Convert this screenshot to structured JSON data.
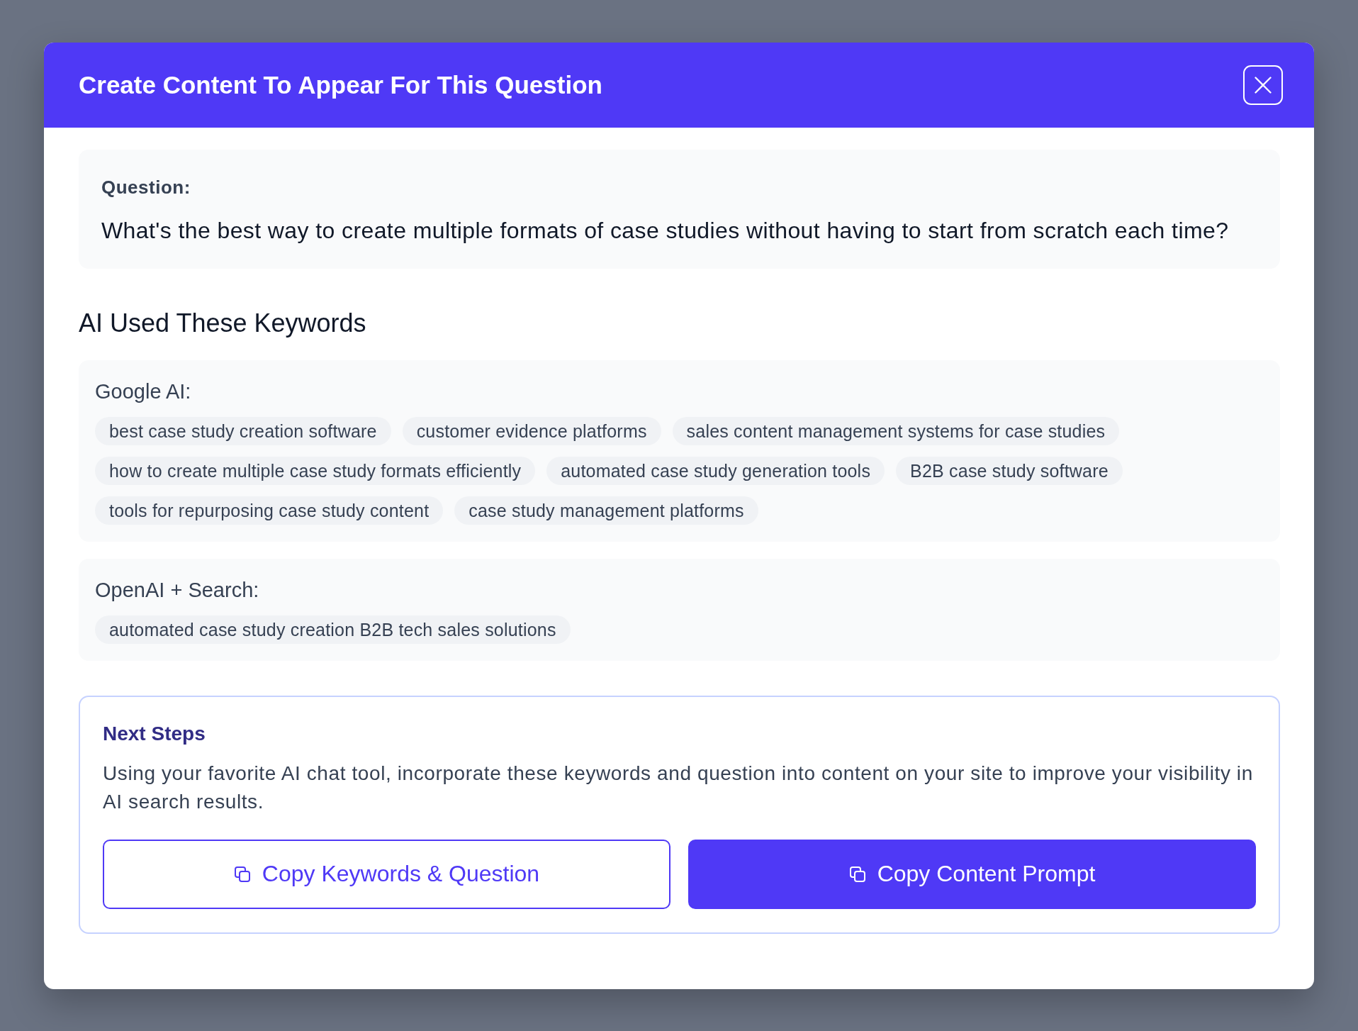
{
  "dialog": {
    "title": "Create Content To Appear For This Question"
  },
  "question": {
    "label": "Question:",
    "text": "What's the best way to create multiple formats of case studies without having to start from scratch each time?"
  },
  "keywords_section": {
    "heading": "AI Used These Keywords",
    "groups": [
      {
        "label": "Google AI:",
        "keywords": [
          "best case study creation software",
          "customer evidence platforms",
          "sales content management systems for case studies",
          "how to create multiple case study formats efficiently",
          "automated case study generation tools",
          "B2B case study software",
          "tools for repurposing case study content",
          "case study management platforms"
        ]
      },
      {
        "label": "OpenAI + Search:",
        "keywords": [
          "automated case study creation B2B tech sales solutions"
        ]
      }
    ]
  },
  "next_steps": {
    "heading": "Next Steps",
    "description": "Using your favorite AI chat tool, incorporate these keywords and question into content on your site to improve your visibility in AI search results.",
    "buttons": [
      {
        "label": "Copy Keywords & Question",
        "kind": "outline"
      },
      {
        "label": "Copy Content Prompt",
        "kind": "primary"
      }
    ]
  }
}
